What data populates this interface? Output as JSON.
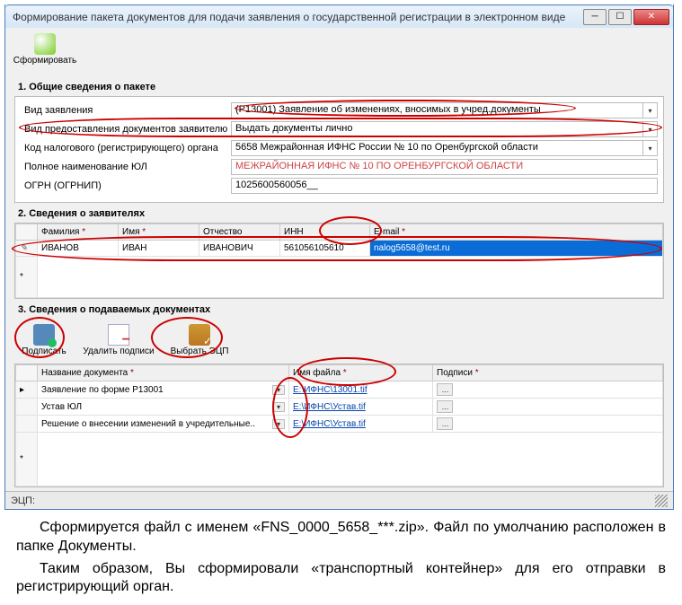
{
  "window": {
    "title": "Формирование пакета документов для подачи заявления о государственной регистрации в электронном виде"
  },
  "toolbar": {
    "form_label": "Сформировать"
  },
  "section1": {
    "title": "1. Общие сведения о пакете",
    "rows": {
      "kind_label": "Вид заявления",
      "kind_value": "(Р13001) Заявление об изменениях, вносимых в учред.документы",
      "delivery_label": "Вид предоставления документов заявителю",
      "delivery_value": "Выдать документы лично",
      "taxcode_label": "Код налогового (регистрирующего) органа",
      "taxcode_value": "5658 Межрайонная ИФНС России № 10 по Оренбургской области",
      "fullname_label": "Полное наименование ЮЛ",
      "fullname_value": "МЕЖРАЙОННАЯ ИФНС № 10 ПО ОРЕНБУРГСКОЙ ОБЛАСТИ",
      "ogrn_label": "ОГРН (ОГРНИП)",
      "ogrn_value": "1025600560056__"
    }
  },
  "section2": {
    "title": "2. Сведения о заявителях",
    "headers": {
      "lastname": "Фамилия",
      "firstname": "Имя",
      "patronymic": "Отчество",
      "inn": "ИНН",
      "email": "E-mail"
    },
    "rows": [
      {
        "lastname": "ИВАНОВ",
        "firstname": "ИВАН",
        "patronymic": "ИВАНОВИЧ",
        "inn": "561056105610",
        "email": "nalog5658@test.ru"
      }
    ]
  },
  "section3": {
    "title": "3. Сведения о подаваемых документах",
    "actions": {
      "sign": "Подписать",
      "delete_sigs": "Удалить подписи",
      "select_cert": "Выбрать ЭЦП"
    },
    "headers": {
      "docname": "Название документа",
      "filename": "Имя файла",
      "sigs": "Подписи"
    },
    "rows": [
      {
        "docname": "Заявление по форме Р13001",
        "filename": "Е:\\ИФНС\\13001.tif"
      },
      {
        "docname": "Устав ЮЛ",
        "filename": "Е:\\ИФНС\\Устав.tif"
      },
      {
        "docname": "Решение о внесении изменений в учредительные..",
        "filename": "Е:\\ИФНС\\Устав.tif"
      }
    ]
  },
  "statusbar": {
    "label": "ЭЦП:"
  },
  "caption": {
    "line1": "Сформируется файл с именем «FNS_0000_5658_***.zip». Файл по умолчанию расположен в папке Документы.",
    "line2": "Таким образом, Вы сформировали «транспортный контейнер» для его отправки в регистрирующий орган."
  }
}
